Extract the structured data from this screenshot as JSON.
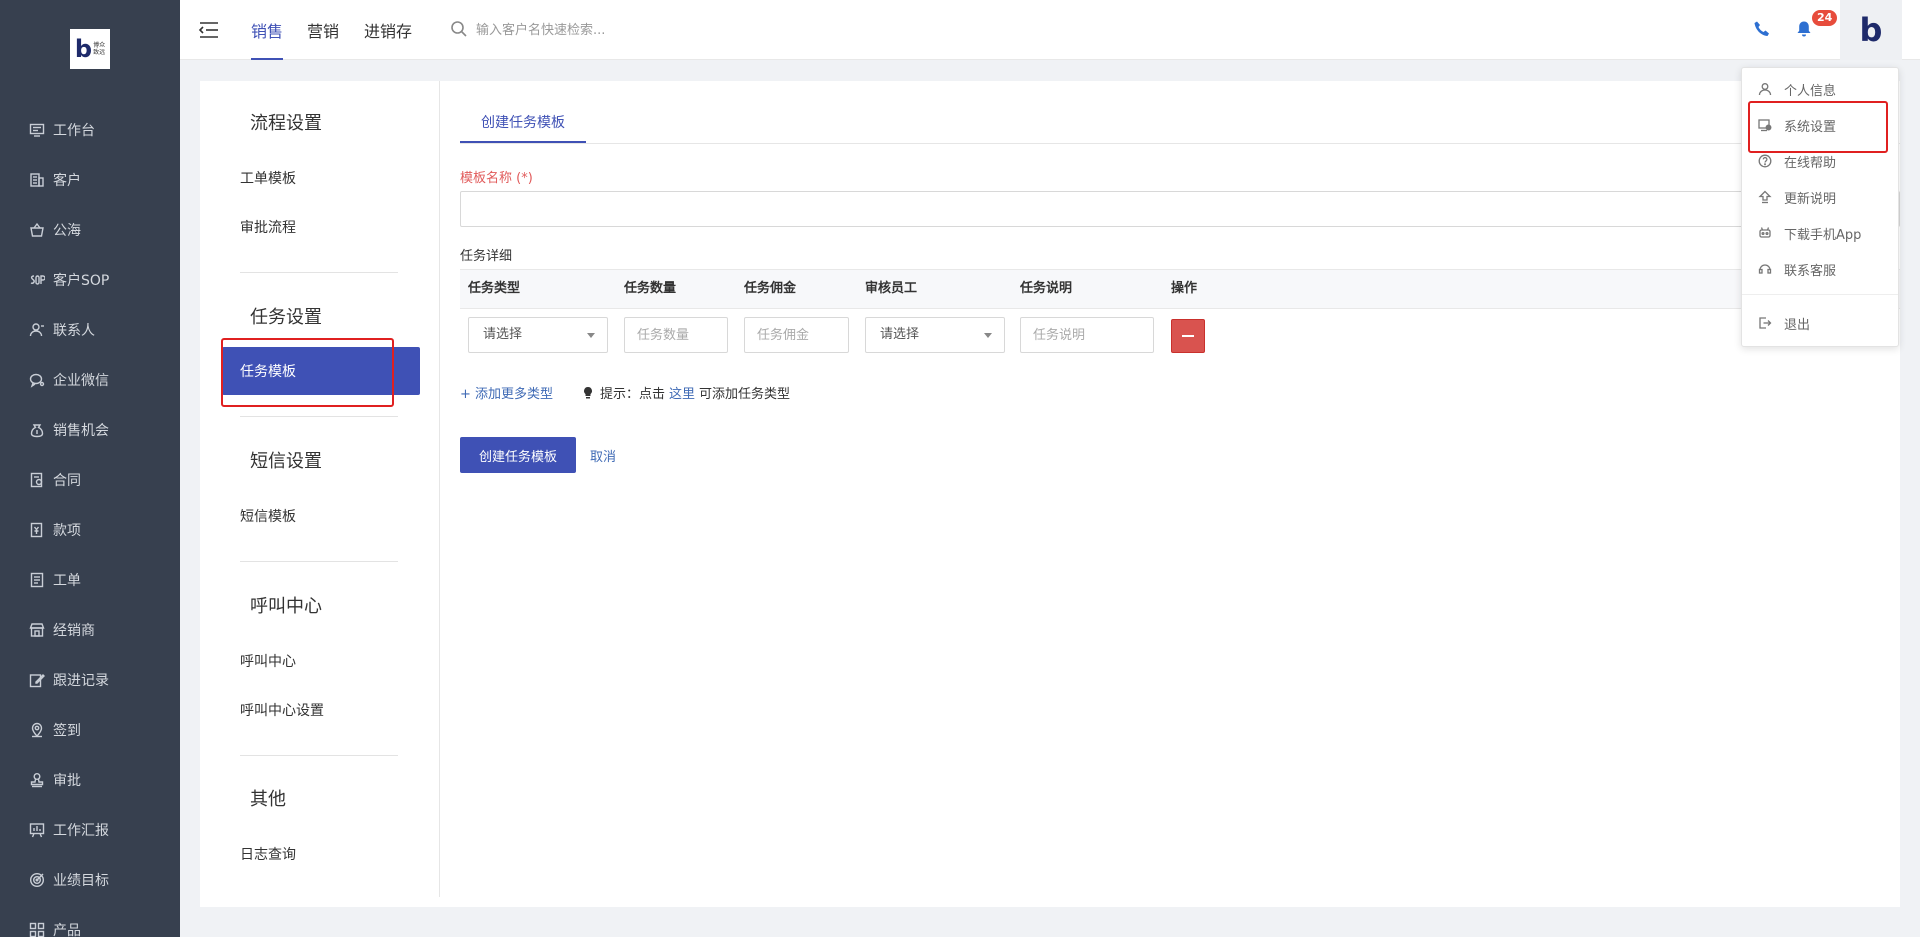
{
  "brand": {
    "logo_text": "博众\n致远",
    "logo_letter": "b"
  },
  "sidebar": {
    "items": [
      {
        "label": "工作台",
        "icon": "desktop-icon"
      },
      {
        "label": "客户",
        "icon": "building-icon"
      },
      {
        "label": "公海",
        "icon": "basket-icon"
      },
      {
        "label": "客户SOP",
        "icon": "sop-icon"
      },
      {
        "label": "联系人",
        "icon": "contact-icon"
      },
      {
        "label": "企业微信",
        "icon": "chat-icon"
      },
      {
        "label": "销售机会",
        "icon": "money-bag-icon"
      },
      {
        "label": "合同",
        "icon": "contract-icon"
      },
      {
        "label": "款项",
        "icon": "payment-icon"
      },
      {
        "label": "工单",
        "icon": "ticket-icon"
      },
      {
        "label": "经销商",
        "icon": "store-icon"
      },
      {
        "label": "跟进记录",
        "icon": "edit-icon"
      },
      {
        "label": "签到",
        "icon": "location-icon"
      },
      {
        "label": "审批",
        "icon": "stamp-icon"
      },
      {
        "label": "工作汇报",
        "icon": "report-icon"
      },
      {
        "label": "业绩目标",
        "icon": "target-icon"
      },
      {
        "label": "产品",
        "icon": "grid-icon"
      }
    ]
  },
  "header": {
    "tabs": [
      {
        "label": "销售",
        "active": true
      },
      {
        "label": "营销",
        "active": false
      },
      {
        "label": "进销存",
        "active": false
      }
    ],
    "search_placeholder": "输入客户名快速检索...",
    "notification_count": "24"
  },
  "settings_nav": {
    "sections": [
      {
        "title": "流程设置",
        "items": [
          "工单模板",
          "审批流程"
        ]
      },
      {
        "title": "任务设置",
        "items": [
          "任务模板"
        ],
        "active_item": "任务模板"
      },
      {
        "title": "短信设置",
        "items": [
          "短信模板"
        ]
      },
      {
        "title": "呼叫中心",
        "items": [
          "呼叫中心",
          "呼叫中心设置"
        ]
      },
      {
        "title": "其他",
        "items": [
          "日志查询"
        ]
      }
    ]
  },
  "form": {
    "tab_label": "创建任务模板",
    "name_label": "模板名称 (*)",
    "name_value": "",
    "detail_label": "任务详细",
    "columns": [
      "任务类型",
      "任务数量",
      "任务佣金",
      "审核员工",
      "任务说明",
      "操作"
    ],
    "row": {
      "task_type": "请选择",
      "quantity_placeholder": "任务数量",
      "commission_placeholder": "任务佣金",
      "reviewer": "请选择",
      "description_placeholder": "任务说明"
    },
    "add_more_label": "+ 添加更多类型",
    "hint_prefix": "提示：点击",
    "hint_link": "这里",
    "hint_suffix": "可添加任务类型",
    "submit_label": "创建任务模板",
    "cancel_label": "取消"
  },
  "user_menu": {
    "items": [
      {
        "label": "个人信息",
        "icon": "user-icon"
      },
      {
        "label": "系统设置",
        "icon": "settings-icon"
      },
      {
        "label": "在线帮助",
        "icon": "help-icon"
      },
      {
        "label": "更新说明",
        "icon": "upload-icon"
      },
      {
        "label": "下载手机App",
        "icon": "robot-icon"
      },
      {
        "label": "联系客服",
        "icon": "headset-icon"
      },
      {
        "label": "退出",
        "icon": "logout-icon"
      }
    ]
  },
  "colors": {
    "accent": "#3f51b5",
    "sidebar_bg": "#37404f",
    "highlight": "#e02020",
    "danger": "#d9534f"
  }
}
